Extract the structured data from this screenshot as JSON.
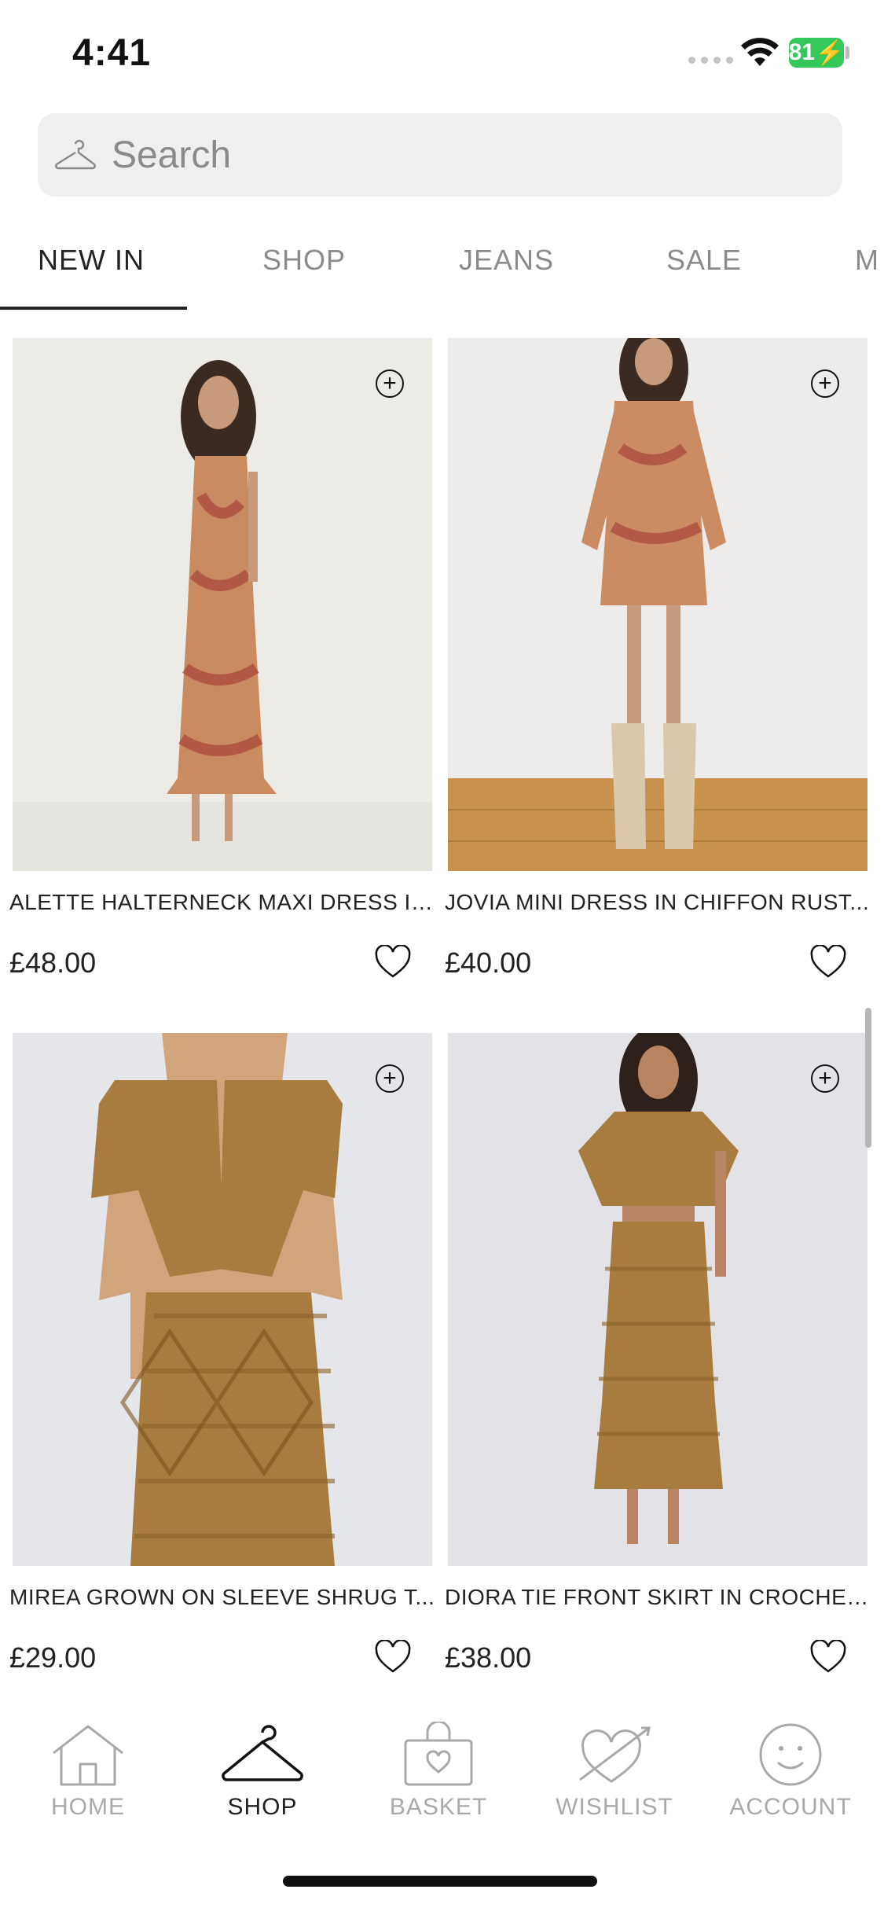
{
  "status_bar": {
    "time": "4:41",
    "battery": "81"
  },
  "search": {
    "placeholder": "Search"
  },
  "tabs": [
    {
      "label": "NEW IN",
      "active": true
    },
    {
      "label": "SHOP",
      "active": false
    },
    {
      "label": "JEANS",
      "active": false
    },
    {
      "label": "SALE",
      "active": false
    },
    {
      "label": "M",
      "active": false
    }
  ],
  "products": [
    {
      "name": "ALETTE HALTERNECK MAXI DRESS IN...",
      "price": "£48.00"
    },
    {
      "name": "JOVIA MINI DRESS IN CHIFFON RUST...",
      "price": "£40.00"
    },
    {
      "name": "MIREA GROWN ON SLEEVE SHRUG T...",
      "price": "£29.00"
    },
    {
      "name": "DIORA TIE FRONT SKIRT IN CROCHET...",
      "price": "£38.00"
    }
  ],
  "bottom_nav": [
    {
      "label": "HOME",
      "icon": "home-icon",
      "active": false
    },
    {
      "label": "SHOP",
      "icon": "hanger-icon",
      "active": true
    },
    {
      "label": "BASKET",
      "icon": "basket-icon",
      "active": false
    },
    {
      "label": "WISHLIST",
      "icon": "wishlist-icon",
      "active": false
    },
    {
      "label": "ACCOUNT",
      "icon": "account-icon",
      "active": false
    }
  ],
  "colors": {
    "battery": "#34c759",
    "active_text": "#222222",
    "inactive_text": "#8b8b8b"
  }
}
